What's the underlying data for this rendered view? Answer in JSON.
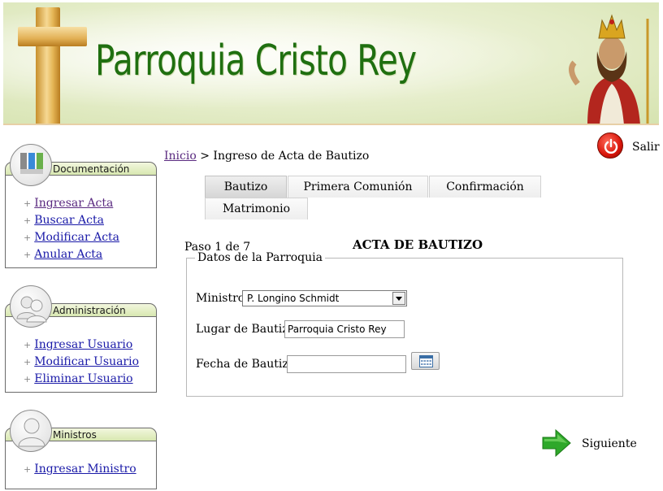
{
  "header": {
    "title": "Parroquia Cristo Rey",
    "icon": "cross-icon"
  },
  "sidebar": {
    "panels": [
      {
        "title": "Documentación",
        "icon": "documents-icon",
        "items": [
          "Ingresar Acta",
          "Buscar Acta",
          "Modificar Acta",
          "Anular Acta"
        ]
      },
      {
        "title": "Administración",
        "icon": "users-icon",
        "items": [
          "Ingresar Usuario",
          "Modificar Usuario",
          "Eliminar Usuario"
        ]
      },
      {
        "title": "Ministros",
        "icon": "user-icon",
        "items": [
          "Ingresar Ministro"
        ]
      }
    ]
  },
  "breadcrumb": {
    "home": "Inicio",
    "separator": ">",
    "current": "Ingreso de Acta de Bautizo"
  },
  "logout": {
    "label": "Salir"
  },
  "tabs": [
    "Bautizo",
    "Primera Comunión",
    "Confirmación",
    "Matrimonio"
  ],
  "form": {
    "step": "Paso 1 de 7",
    "title": "ACTA DE BAUTIZO",
    "legend": "Datos de la Parroquia",
    "ministro_label": "Ministro:",
    "ministro_value": "P. Longino Schmidt",
    "lugar_label": "Lugar de Bautizo:",
    "lugar_value": "Parroquia Cristo Rey",
    "fecha_label": "Fecha de Bautizo:",
    "fecha_value": ""
  },
  "next": {
    "label": "Siguiente"
  },
  "colors": {
    "title_green": "#1f6f10",
    "link": "#1a1aa8",
    "visited": "#5a2a80",
    "arrow_green": "#2ea82a"
  }
}
